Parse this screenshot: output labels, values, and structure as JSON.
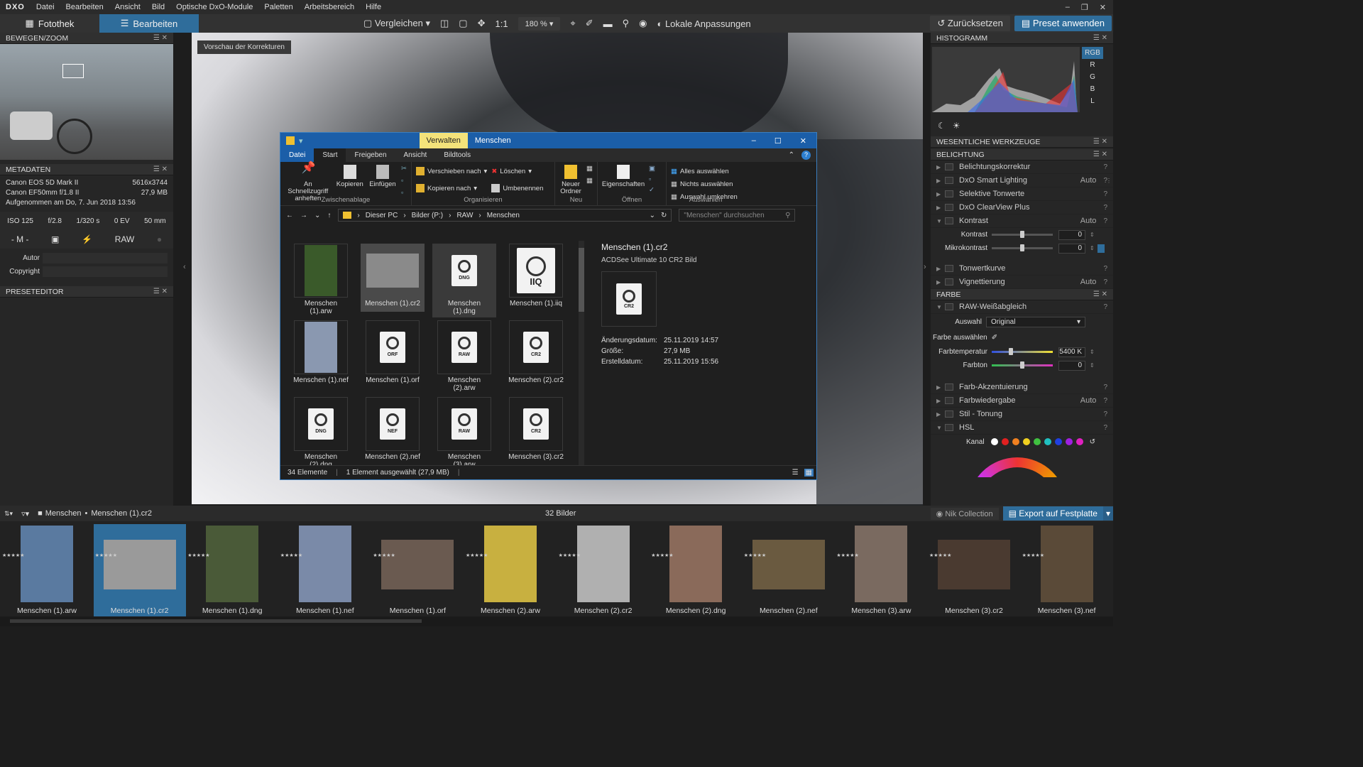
{
  "app": {
    "logo": "DXO",
    "menu": [
      "Datei",
      "Bearbeiten",
      "Ansicht",
      "Bild",
      "Optische DxO-Module",
      "Paletten",
      "Arbeitsbereich",
      "Hilfe"
    ]
  },
  "toolbar": {
    "tab_library": "Fotothek",
    "tab_edit": "Bearbeiten",
    "compare": "Vergleichen",
    "ratio": "1:1",
    "zoom": "180 %",
    "local": "Lokale Anpassungen",
    "reset": "Zurücksetzen",
    "apply_preset": "Preset anwenden"
  },
  "left": {
    "move_zoom_title": "BEWEGEN/ZOOM",
    "metadata_title": "METADATEN",
    "camera": "Canon EOS 5D Mark II",
    "resolution": "5616x3744",
    "lens": "Canon EF50mm f/1.8 II",
    "filesize": "27,9 MB",
    "taken": "Aufgenommen am Do, 7. Jun 2018 13:56",
    "exif": [
      "ISO 125",
      "f/2.8",
      "1/320 s",
      "0 EV",
      "50 mm"
    ],
    "mode": "- M -",
    "raw": "RAW",
    "author_label": "Autor",
    "copyright_label": "Copyright",
    "preset_title": "PRESETEDITOR"
  },
  "viewer": {
    "preview_label": "Vorschau der Korrekturen"
  },
  "explorer": {
    "manage_tab": "Verwalten",
    "title": "Menschen",
    "tabs": [
      "Datei",
      "Start",
      "Freigeben",
      "Ansicht",
      "Bildtools"
    ],
    "ribbon": {
      "pin": "An Schnellzugriff anheften",
      "copy": "Kopieren",
      "paste": "Einfügen",
      "clipboard": "Zwischenablage",
      "move_to": "Verschieben nach",
      "copy_to": "Kopieren nach",
      "delete": "Löschen",
      "rename": "Umbenennen",
      "organize": "Organisieren",
      "new_folder": "Neuer Ordner",
      "new": "Neu",
      "properties": "Eigenschaften",
      "open": "Öffnen",
      "select_all": "Alles auswählen",
      "select_none": "Nichts auswählen",
      "invert": "Auswahl umkehren",
      "select": "Auswählen"
    },
    "path": [
      "Dieser PC",
      "Bilder (P:)",
      "RAW",
      "Menschen"
    ],
    "search_placeholder": "\"Menschen\" durchsuchen",
    "files": [
      {
        "name": "Menschen (1).arw",
        "kind": "photo",
        "color": "#3a5a2a"
      },
      {
        "name": "Menschen (1).cr2",
        "kind": "photo",
        "color": "#8a8a8a"
      },
      {
        "name": "Menschen (1).dng",
        "kind": "doc",
        "tag": "DNG"
      },
      {
        "name": "Menschen (1).iiq",
        "kind": "iiq",
        "tag": "IIQ"
      },
      {
        "name": "Menschen (1).nef",
        "kind": "photo",
        "color": "#8a98b0"
      },
      {
        "name": "Menschen (1).orf",
        "kind": "doc",
        "tag": "ORF"
      },
      {
        "name": "Menschen (2).arw",
        "kind": "raw",
        "tag": "RAW"
      },
      {
        "name": "Menschen (2).cr2",
        "kind": "doc",
        "tag": "CR2"
      },
      {
        "name": "Menschen (2).dng",
        "kind": "doc",
        "tag": "DNG"
      },
      {
        "name": "Menschen (2).nef",
        "kind": "doc",
        "tag": "NEF"
      },
      {
        "name": "Menschen (3).arw",
        "kind": "raw",
        "tag": "RAW"
      },
      {
        "name": "Menschen (3).cr2",
        "kind": "doc",
        "tag": "CR2"
      }
    ],
    "preview": {
      "name": "Menschen (1).cr2",
      "type": "ACDSee Ultimate 10 CR2 Bild",
      "tag": "CR2",
      "modified_label": "Änderungsdatum:",
      "modified": "25.11.2019 14:57",
      "size_label": "Größe:",
      "size": "27,9 MB",
      "created_label": "Erstelldatum:",
      "created": "25.11.2019 15:56"
    },
    "status_count": "34 Elemente",
    "status_sel": "1 Element ausgewählt (27,9 MB)"
  },
  "right": {
    "histogram_title": "HISTOGRAMM",
    "channels": [
      "RGB",
      "R",
      "G",
      "B",
      "L"
    ],
    "essentials_title": "WESENTLICHE WERKZEUGE",
    "exposure_title": "BELICHTUNG",
    "exposure_items": [
      {
        "label": "Belichtungskorrektur",
        "auto": ""
      },
      {
        "label": "DxO Smart Lighting",
        "auto": "Auto"
      },
      {
        "label": "Selektive Tonwerte",
        "auto": ""
      },
      {
        "label": "DxO ClearView Plus",
        "auto": ""
      },
      {
        "label": "Kontrast",
        "auto": "Auto"
      }
    ],
    "contrast_label": "Kontrast",
    "contrast_value": "0",
    "micro_label": "Mikrokontrast",
    "micro_value": "0",
    "tone_items": [
      {
        "label": "Tonwertkurve",
        "auto": ""
      },
      {
        "label": "Vignettierung",
        "auto": "Auto"
      }
    ],
    "color_title": "FARBE",
    "wb_label": "RAW-Weißabgleich",
    "select_label": "Auswahl",
    "select_value": "Original",
    "pick_label": "Farbe auswählen",
    "temp_label": "Farbtemperatur",
    "temp_value": "5400 K",
    "tint_label": "Farbton",
    "tint_value": "0",
    "color_items": [
      {
        "label": "Farb-Akzentuierung",
        "auto": ""
      },
      {
        "label": "Farbwiedergabe",
        "auto": "Auto"
      },
      {
        "label": "Stil - Tonung",
        "auto": ""
      },
      {
        "label": "HSL",
        "auto": ""
      }
    ],
    "channel_label": "Kanal",
    "hsl_colors": [
      "#ffffff",
      "#e02020",
      "#f08020",
      "#f0d020",
      "#40c040",
      "#20c0c0",
      "#2040e0",
      "#a020e0",
      "#e020c0"
    ]
  },
  "filmstrip": {
    "breadcrumb_folder": "Menschen",
    "breadcrumb_file": "Menschen (1).cr2",
    "count": "32 Bilder",
    "nik": "Nik Collection",
    "export": "Export auf Festplatte",
    "items": [
      {
        "name": "Menschen (1).arw",
        "color": "#5a7aa0"
      },
      {
        "name": "Menschen (1).cr2",
        "color": "#9a9a9a"
      },
      {
        "name": "Menschen (1).dng",
        "color": "#4a5a38"
      },
      {
        "name": "Menschen (1).nef",
        "color": "#7a8aa8"
      },
      {
        "name": "Menschen (1).orf",
        "color": "#6a5a50"
      },
      {
        "name": "Menschen (2).arw",
        "color": "#c8b040"
      },
      {
        "name": "Menschen (2).cr2",
        "color": "#b0b0b0"
      },
      {
        "name": "Menschen (2).dng",
        "color": "#8a6a5a"
      },
      {
        "name": "Menschen (2).nef",
        "color": "#6a5a40"
      },
      {
        "name": "Menschen (3).arw",
        "color": "#7a6a60"
      },
      {
        "name": "Menschen (3).cr2",
        "color": "#4a3a30"
      },
      {
        "name": "Menschen (3).nef",
        "color": "#5a4a38"
      }
    ]
  }
}
